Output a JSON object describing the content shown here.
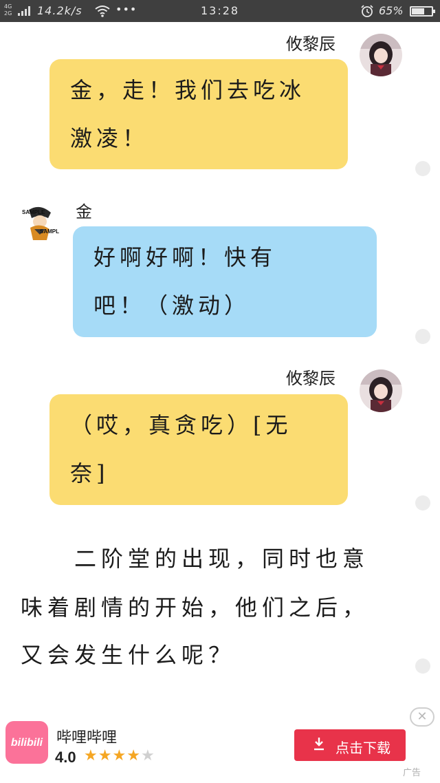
{
  "status_bar": {
    "network": "4G 2G",
    "speed": "14.2k/s",
    "more": "•••",
    "time": "13:28",
    "battery": "65%",
    "battery_level": 0.65
  },
  "chat": [
    {
      "sender": "攸黎辰",
      "side": "right",
      "color": "yellow",
      "lines": [
        "金，走！我们去吃冰",
        "激凌！"
      ]
    },
    {
      "sender": "金",
      "side": "left",
      "color": "blue",
      "lines": [
        "好啊好啊！快有",
        "吧！（激动）"
      ]
    },
    {
      "sender": "攸黎辰",
      "side": "right",
      "color": "yellow",
      "lines": [
        "（哎，真贪吃）[无",
        "奈]"
      ]
    }
  ],
  "narration": [
    "二阶堂的出现，同时也意",
    "味着剧情的开始，他们之后，",
    "又会发生什么呢？"
  ],
  "watermark": "SAMPLE",
  "ad": {
    "app_name": "哔哩哔哩",
    "logo_text": "bilibili",
    "rating": "4.0",
    "stars_filled": 4,
    "stars_total": 5,
    "button_label": "点击下载",
    "close_symbol": "✕",
    "tag": "广告"
  },
  "colors": {
    "yellow_bubble": "#fbdc72",
    "blue_bubble": "#a6dbf7",
    "status_bar": "#3f3f3f",
    "ad_button": "#e8334a",
    "star": "#f5a623"
  }
}
